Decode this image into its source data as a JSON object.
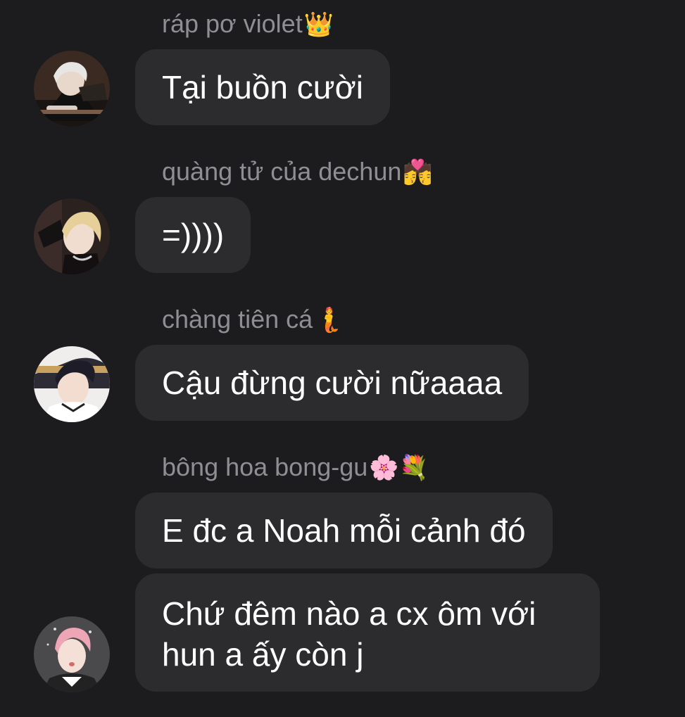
{
  "conversation": {
    "messages": [
      {
        "sender": "ráp pơ violet",
        "sender_emoji": "👑",
        "avatar_icon": "avatar-anime-white-hair",
        "lines": [
          "Tại buồn cười"
        ]
      },
      {
        "sender": "quàng tử của dechun",
        "sender_emoji": "💏",
        "avatar_icon": "avatar-anime-blond-hair",
        "lines": [
          "=))))"
        ]
      },
      {
        "sender": "chàng tiên cá",
        "sender_emoji": "🧜",
        "avatar_icon": "avatar-anime-dark-hair",
        "lines": [
          "Cậu đừng cười nữaaaa"
        ]
      },
      {
        "sender": "bông hoa bong-gu",
        "sender_emoji": "🌸💐",
        "avatar_icon": "avatar-anime-pink-hair",
        "lines": [
          "E đc a Noah mỗi cảnh đó"
        ]
      },
      {
        "sender": "",
        "lines": [
          "Chứ đêm nào a cx ôm với",
          "hun a ấy còn j"
        ]
      }
    ]
  },
  "colors": {
    "background": "#1c1c1e",
    "bubble": "#2c2c2e",
    "sender_name": "#8e8e93",
    "message_text": "#ffffff"
  }
}
